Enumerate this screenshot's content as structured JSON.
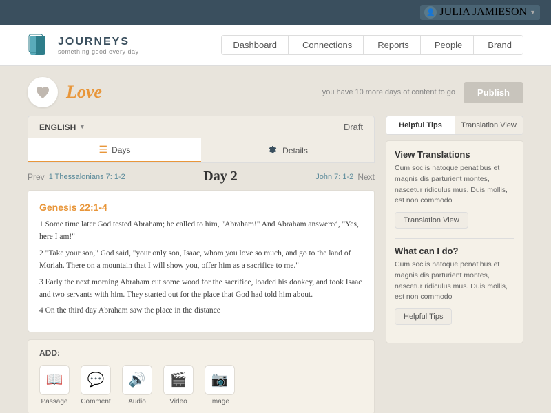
{
  "topbar": {
    "user_name": "JULIA JAMIESON",
    "user_icon": "👤"
  },
  "nav": {
    "logo_title": "JOURNEYS",
    "logo_subtitle": "something good every day",
    "links": [
      {
        "label": "Dashboard",
        "id": "dashboard"
      },
      {
        "label": "Connections",
        "id": "connections"
      },
      {
        "label": "Reports",
        "id": "reports"
      },
      {
        "label": "People",
        "id": "people"
      },
      {
        "label": "Brand",
        "id": "brand"
      }
    ]
  },
  "content_header": {
    "title": "Love",
    "publish_hint": "you have 10 more days of content to go",
    "publish_label": "Publish"
  },
  "lang_bar": {
    "language": "ENGLISH",
    "draft": "Draft"
  },
  "day_tabs": {
    "days_label": "Days",
    "details_label": "Details"
  },
  "day_nav": {
    "prev": "Prev",
    "prev_ref": "1 Thessalonians 7: 1-2",
    "day": "Day 2",
    "next_ref": "John 7: 1-2",
    "next": "Next"
  },
  "passage": {
    "title": "Genesis 22:1-4",
    "verses": [
      "1 Some time later God tested Abraham; he called to him, \"Abraham!\" And Abraham answered, \"Yes, here I am!\"",
      "2 \"Take your son,\" God said, \"your only son, Isaac, whom you love so much, and go to the land of Moriah. There on a mountain that I will show you, offer him as a sacrifice to me.\"",
      "3 Early the next morning Abraham cut some wood for the sacrifice, loaded his donkey, and took Isaac and two servants with him. They started out for the place that God had told him about.",
      "4 On the third day Abraham saw the place in the distance"
    ]
  },
  "add_section": {
    "label": "ADD:",
    "items": [
      {
        "label": "Passage",
        "icon": "📖",
        "color": "#3a7a8a"
      },
      {
        "label": "Comment",
        "icon": "💬",
        "color": "#e8963a"
      },
      {
        "label": "Audio",
        "icon": "🔊",
        "color": "#5aabba"
      },
      {
        "label": "Video",
        "icon": "🎬",
        "color": "#444"
      },
      {
        "label": "Image",
        "icon": "📷",
        "color": "#e8963a"
      }
    ]
  },
  "right_tabs": [
    {
      "label": "Helpful Tips",
      "id": "helpful-tips"
    },
    {
      "label": "Translation View",
      "id": "translation-view"
    }
  ],
  "right_sections": [
    {
      "id": "view-translations",
      "title": "View Translations",
      "text": "Cum sociis natoque penatibus et magnis dis parturient montes, nascetur ridiculus mus. Duis mollis, est non commodo",
      "button_label": "Translation View"
    },
    {
      "id": "what-can-i-do",
      "title": "What can I do?",
      "text": "Cum sociis natoque penatibus et magnis dis parturient montes, nascetur ridiculus mus. Duis mollis, est non commodo",
      "button_label": "Helpful Tips"
    }
  ]
}
